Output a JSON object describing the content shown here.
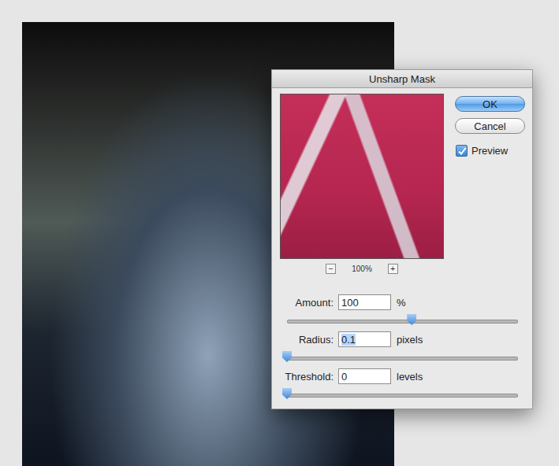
{
  "window": {
    "title": "Unsharp Mask"
  },
  "preview_zoom": {
    "minus": "−",
    "zoom": "100%",
    "plus": "+"
  },
  "buttons": [
    {
      "label": "OK",
      "default": true
    },
    {
      "label": "Cancel",
      "default": false
    }
  ],
  "preview_checkbox": {
    "label": "Preview",
    "checked": true
  },
  "fields": [
    {
      "label": "Amount:",
      "value": "100",
      "unit": "%",
      "level": 0.54,
      "selected": false
    },
    {
      "label": "Radius:",
      "value": "0.1",
      "unit": "pixels",
      "level": 0,
      "selected": true
    },
    {
      "label": "Threshold:",
      "value": "0",
      "unit": "levels",
      "level": 0,
      "selected": false
    }
  ]
}
